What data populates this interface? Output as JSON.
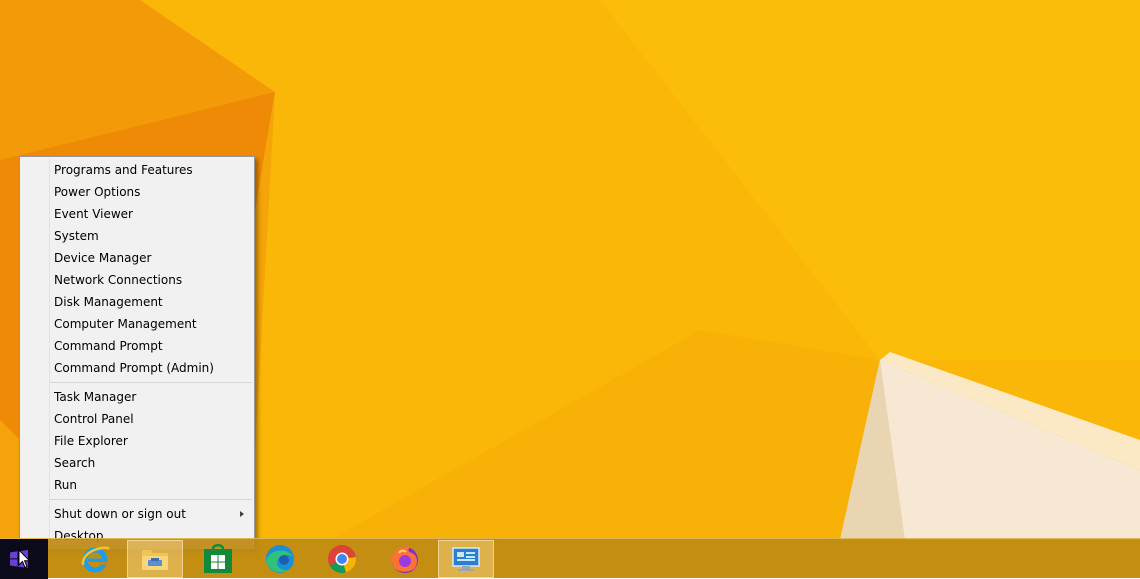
{
  "menu": {
    "group1": [
      {
        "label": "Programs and Features"
      },
      {
        "label": "Power Options"
      },
      {
        "label": "Event Viewer"
      },
      {
        "label": "System"
      },
      {
        "label": "Device Manager"
      },
      {
        "label": "Network Connections"
      },
      {
        "label": "Disk Management"
      },
      {
        "label": "Computer Management"
      },
      {
        "label": "Command Prompt"
      },
      {
        "label": "Command Prompt (Admin)"
      }
    ],
    "group2": [
      {
        "label": "Task Manager"
      },
      {
        "label": "Control Panel"
      },
      {
        "label": "File Explorer"
      },
      {
        "label": "Search"
      },
      {
        "label": "Run"
      }
    ],
    "group3": [
      {
        "label": "Shut down or sign out",
        "has_submenu": true
      },
      {
        "label": "Desktop"
      }
    ]
  },
  "taskbar": {
    "items": [
      {
        "icon": "internet-explorer-icon",
        "active": false
      },
      {
        "icon": "file-explorer-icon",
        "active": true
      },
      {
        "icon": "store-icon",
        "active": false
      },
      {
        "icon": "edge-icon",
        "active": false
      },
      {
        "icon": "chrome-icon",
        "active": false
      },
      {
        "icon": "firefox-icon",
        "active": false
      },
      {
        "icon": "control-panel-icon",
        "active": true
      }
    ]
  },
  "colors": {
    "wallpaper_primary": "#fbb707",
    "wallpaper_dark": "#ee8a06",
    "wallpaper_cream": "#f6e8d2",
    "menu_background": "#f1f1f1",
    "taskbar": "#be8a14"
  }
}
